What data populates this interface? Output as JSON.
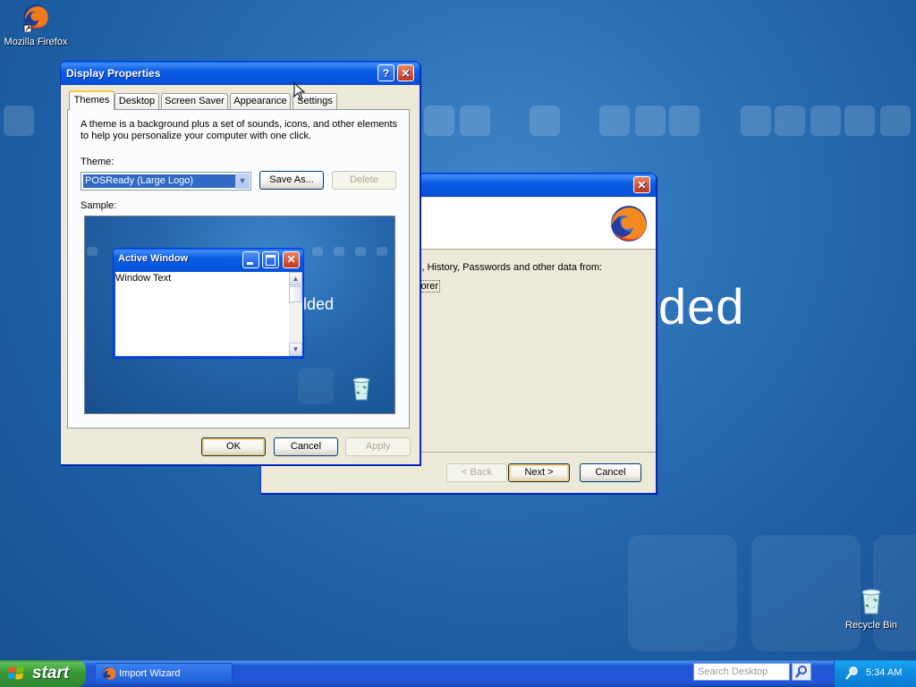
{
  "desktop": {
    "firefox_icon_label": "Mozilla Firefox",
    "recycle_bin_label": "Recycle Bin",
    "brand_fragment": "ded"
  },
  "display_properties": {
    "title": "Display Properties",
    "help_label": "?",
    "tabs": [
      {
        "label": "Themes",
        "active": true
      },
      {
        "label": "Desktop",
        "active": false
      },
      {
        "label": "Screen Saver",
        "active": false
      },
      {
        "label": "Appearance",
        "active": false
      },
      {
        "label": "Settings",
        "active": false
      }
    ],
    "description": "A theme is a background plus a set of sounds, icons, and other elements to help you personalize your computer with one click.",
    "theme_label": "Theme:",
    "theme_value": "POSReady (Large Logo)",
    "save_as_label": "Save As...",
    "delete_label": "Delete",
    "sample_label": "Sample:",
    "sample": {
      "window_title": "Active Window",
      "window_text": "Window Text",
      "brand_fragment": "lded"
    },
    "ok_label": "OK",
    "cancel_label": "Cancel",
    "apply_label": "Apply"
  },
  "import_wizard": {
    "body_text": "s, History, Passwords and other data from:",
    "option_fragment": "lorer",
    "back_label": "< Back",
    "next_label": "Next >",
    "cancel_label": "Cancel"
  },
  "taskbar": {
    "start_label": "start",
    "task_label": "Import Wizard",
    "search_placeholder": "Search Desktop",
    "clock": "5:34 AM"
  },
  "colors": {
    "xp_blue_title": "#0553db",
    "desktop_blue": "#2a6fb4",
    "start_green": "#389a38",
    "tray_blue": "#0d8de1"
  }
}
